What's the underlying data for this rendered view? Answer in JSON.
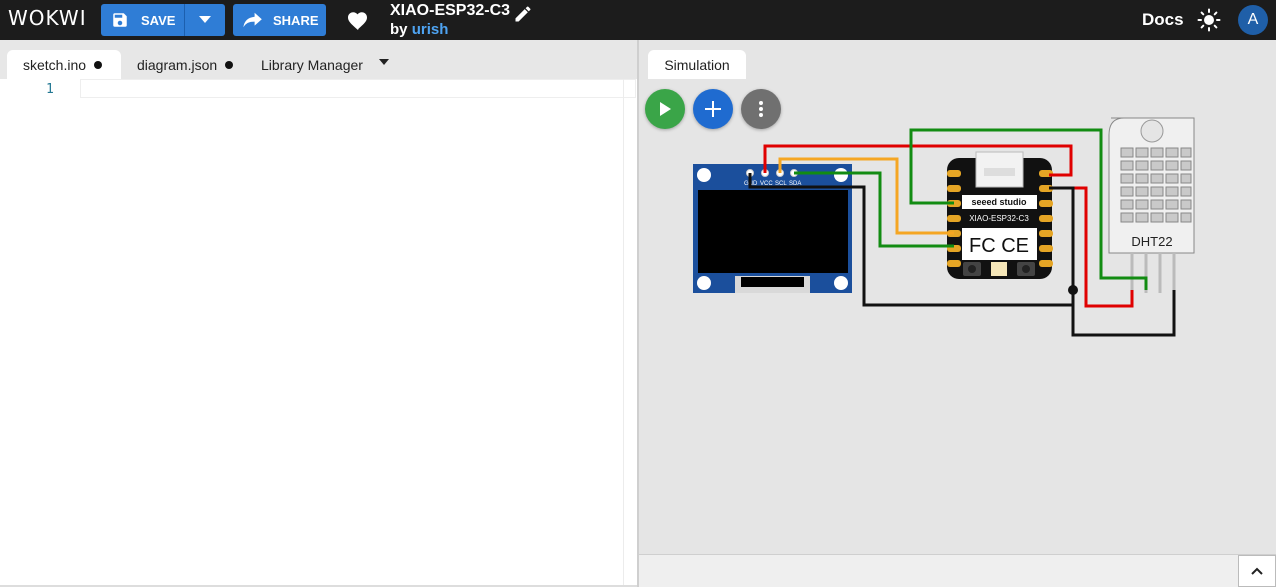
{
  "header": {
    "logo": "WOKWI",
    "save_label": "SAVE",
    "share_label": "SHARE",
    "project_title": "XIAO-ESP32-C3",
    "by_label": "by",
    "author": "urish",
    "docs_label": "Docs",
    "avatar_initial": "A"
  },
  "editor": {
    "tabs": [
      {
        "label": "sketch.ino",
        "unsaved": true,
        "active": true
      },
      {
        "label": "diagram.json",
        "unsaved": true,
        "active": false
      },
      {
        "label": "Library Manager",
        "active": false
      }
    ],
    "line_numbers": [
      "1"
    ]
  },
  "simulation": {
    "tab_label": "Simulation",
    "oled_pin_labels": [
      "GND",
      "VCC",
      "SCL",
      "SDA"
    ],
    "board_brand": "seeed studio",
    "board_model": "XIAO-ESP32-C3",
    "board_cert": "FC CE",
    "sensor_label": "DHT22"
  },
  "colors": {
    "topbar": "#1c1c1c",
    "accent_blue": "#2f7dd6",
    "play_green": "#3aa548",
    "add_blue": "#1f6bd0",
    "wire_red": "#e00000",
    "wire_green": "#128c12",
    "wire_orange": "#f5a623",
    "wire_black": "#111111"
  },
  "icons": [
    "save-icon",
    "chevron-down-icon",
    "share-icon",
    "heart-icon",
    "pencil-icon",
    "sun-icon",
    "play-icon",
    "plus-icon",
    "more-vert-icon",
    "chevron-up-icon"
  ]
}
